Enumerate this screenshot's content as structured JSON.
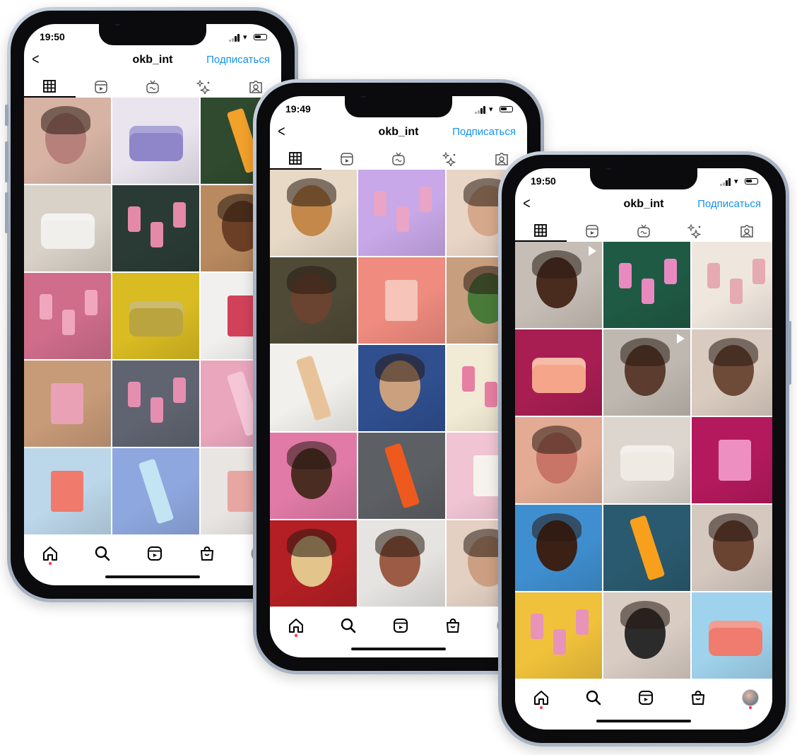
{
  "phones": [
    {
      "status_time": "19:50",
      "username": "okb_int",
      "follow_label": "Подписаться",
      "tabs": [
        "grid-icon",
        "reels-icon",
        "igtv-icon",
        "effects-icon",
        "tagged-icon"
      ],
      "grid": [
        {
          "bg": "#d7b3a4",
          "accent": "#b7807a",
          "kind": "face"
        },
        {
          "bg": "#e9e4ee",
          "accent": "#8f86c9",
          "kind": "jar"
        },
        {
          "bg": "#2f4a2e",
          "accent": "#f2a12b",
          "kind": "tube"
        },
        {
          "bg": "#d9d2c8",
          "accent": "#f1efec",
          "kind": "jar"
        },
        {
          "bg": "#2a3b35",
          "accent": "#e48aa8",
          "kind": "bottles"
        },
        {
          "bg": "#b9895f",
          "accent": "#6b3f25",
          "kind": "face"
        },
        {
          "bg": "#cf6d8b",
          "accent": "#f0a7bd",
          "kind": "bottles"
        },
        {
          "bg": "#d9bb22",
          "accent": "#b9a440",
          "kind": "jar"
        },
        {
          "bg": "#f1f0ef",
          "accent": "#d2415a",
          "kind": "box"
        },
        {
          "bg": "#c79a78",
          "accent": "#e9a1b6",
          "kind": "box"
        },
        {
          "bg": "#5f6470",
          "accent": "#e58eb0",
          "kind": "bottles"
        },
        {
          "bg": "#eaa6bd",
          "accent": "#f5c7d6",
          "kind": "tube"
        },
        {
          "bg": "#bcd7ea",
          "accent": "#f07a6c",
          "kind": "box"
        },
        {
          "bg": "#8ea8df",
          "accent": "#c3e4f3",
          "kind": "tube"
        },
        {
          "bg": "#e9e5e2",
          "accent": "#e8a6a2",
          "kind": "box"
        }
      ]
    },
    {
      "status_time": "19:49",
      "username": "okb_int",
      "follow_label": "Подписаться",
      "tabs": [
        "grid-icon",
        "reels-icon",
        "igtv-icon",
        "effects-icon",
        "tagged-icon"
      ],
      "grid": [
        {
          "bg": "#e7d9c6",
          "accent": "#c4884a",
          "kind": "face"
        },
        {
          "bg": "#c8a8e8",
          "accent": "#e9a4c6",
          "kind": "bottles"
        },
        {
          "bg": "#e9d5c6",
          "accent": "#d6a88b",
          "kind": "face"
        },
        {
          "bg": "#4f4a36",
          "accent": "#6a4430",
          "kind": "face"
        },
        {
          "bg": "#ef8b7f",
          "accent": "#f6c4b8",
          "kind": "box"
        },
        {
          "bg": "#c79e7e",
          "accent": "#4a7a3a",
          "kind": "face"
        },
        {
          "bg": "#f2f0ec",
          "accent": "#e8c39a",
          "kind": "tube"
        },
        {
          "bg": "#2f4f8f",
          "accent": "#caa07f",
          "kind": "face"
        },
        {
          "bg": "#f1ead4",
          "accent": "#e77fa2",
          "kind": "bottles"
        },
        {
          "bg": "#e17aa6",
          "accent": "#4b2c22",
          "kind": "face"
        },
        {
          "bg": "#5c5f63",
          "accent": "#ee5a1d",
          "kind": "tube"
        },
        {
          "bg": "#f0c4d2",
          "accent": "#f6f3ef",
          "kind": "box"
        },
        {
          "bg": "#b31f24",
          "accent": "#e3c48b",
          "kind": "face"
        },
        {
          "bg": "#e6e4e1",
          "accent": "#9c5b44",
          "kind": "face"
        },
        {
          "bg": "#e3d0c3",
          "accent": "#cc9f82",
          "kind": "face"
        }
      ]
    },
    {
      "status_time": "19:50",
      "username": "okb_int",
      "follow_label": "Подписаться",
      "tabs": [
        "grid-icon",
        "reels-icon",
        "igtv-icon",
        "effects-icon",
        "tagged-icon"
      ],
      "grid": [
        {
          "bg": "#c6beb6",
          "accent": "#4a2c1f",
          "kind": "face",
          "play": true
        },
        {
          "bg": "#1f5a45",
          "accent": "#e88ac0",
          "kind": "bottles"
        },
        {
          "bg": "#efe7de",
          "accent": "#e5aab2",
          "kind": "bottles"
        },
        {
          "bg": "#a81e52",
          "accent": "#f4a58a",
          "kind": "jar"
        },
        {
          "bg": "#bfb8b0",
          "accent": "#5b3c2e",
          "kind": "face",
          "play": true
        },
        {
          "bg": "#d9cbbf",
          "accent": "#6e4a38",
          "kind": "face"
        },
        {
          "bg": "#e3ab93",
          "accent": "#c87467",
          "kind": "face"
        },
        {
          "bg": "#ddd6cf",
          "accent": "#efeae4",
          "kind": "jar"
        },
        {
          "bg": "#b3195c",
          "accent": "#ee8fc2",
          "kind": "box"
        },
        {
          "bg": "#3f8fd0",
          "accent": "#3a2015",
          "kind": "face"
        },
        {
          "bg": "#2a5a6f",
          "accent": "#f8a01c",
          "kind": "tube"
        },
        {
          "bg": "#d4c8bf",
          "accent": "#6a4331",
          "kind": "face"
        },
        {
          "bg": "#f0c23b",
          "accent": "#e894b8",
          "kind": "bottles"
        },
        {
          "bg": "#d8ccc3",
          "accent": "#2b2b2b",
          "kind": "face"
        },
        {
          "bg": "#9fd2ec",
          "accent": "#ef7c6e",
          "kind": "jar"
        }
      ]
    }
  ],
  "nav_icons": [
    "home-icon",
    "search-icon",
    "reels-icon",
    "shop-icon",
    "profile-avatar"
  ]
}
